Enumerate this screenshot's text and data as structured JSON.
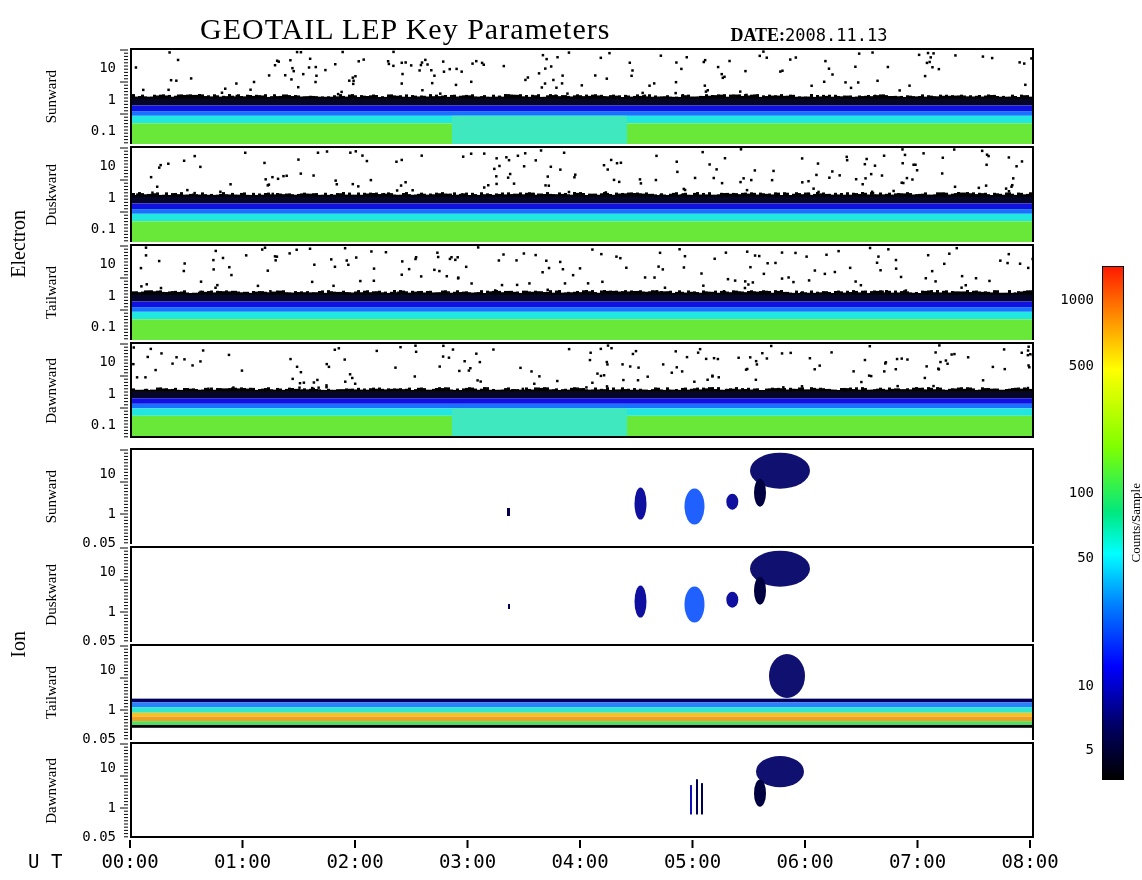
{
  "title": "GEOTAIL LEP Key Parameters",
  "date": {
    "label": "DATE:",
    "value": "2008.11.13"
  },
  "groups": [
    {
      "species": "Electron",
      "panels": [
        {
          "direction": "Sunward",
          "kind": "electron",
          "yticks": [
            "10",
            "1",
            "0.1"
          ]
        },
        {
          "direction": "Duskward",
          "kind": "electron",
          "yticks": [
            "10",
            "1",
            "0.1"
          ]
        },
        {
          "direction": "Tailward",
          "kind": "electron",
          "yticks": [
            "10",
            "1",
            "0.1"
          ]
        },
        {
          "direction": "Dawnward",
          "kind": "electron",
          "yticks": [
            "10",
            "1",
            "0.1"
          ]
        }
      ]
    },
    {
      "species": "Ion",
      "panels": [
        {
          "direction": "Sunward",
          "kind": "ion-bursts",
          "yticks": [
            "10",
            "1",
            "0.05"
          ]
        },
        {
          "direction": "Duskward",
          "kind": "ion-bursts",
          "yticks": [
            "10",
            "1",
            "0.05"
          ]
        },
        {
          "direction": "Tailward",
          "kind": "ion-band",
          "yticks": [
            "10",
            "1",
            "0.05"
          ]
        },
        {
          "direction": "Dawnward",
          "kind": "ion-bursts",
          "yticks": [
            "10",
            "1",
            "0.05"
          ]
        }
      ]
    }
  ],
  "time_axis": {
    "label": "U T",
    "ticks": [
      "00:00",
      "01:00",
      "02:00",
      "03:00",
      "04:00",
      "05:00",
      "06:00",
      "07:00",
      "08:00"
    ]
  },
  "colorbar": {
    "label": "Counts/Sample",
    "ticks": [
      "1000",
      "500",
      "100",
      "50",
      "10",
      "5"
    ]
  }
}
